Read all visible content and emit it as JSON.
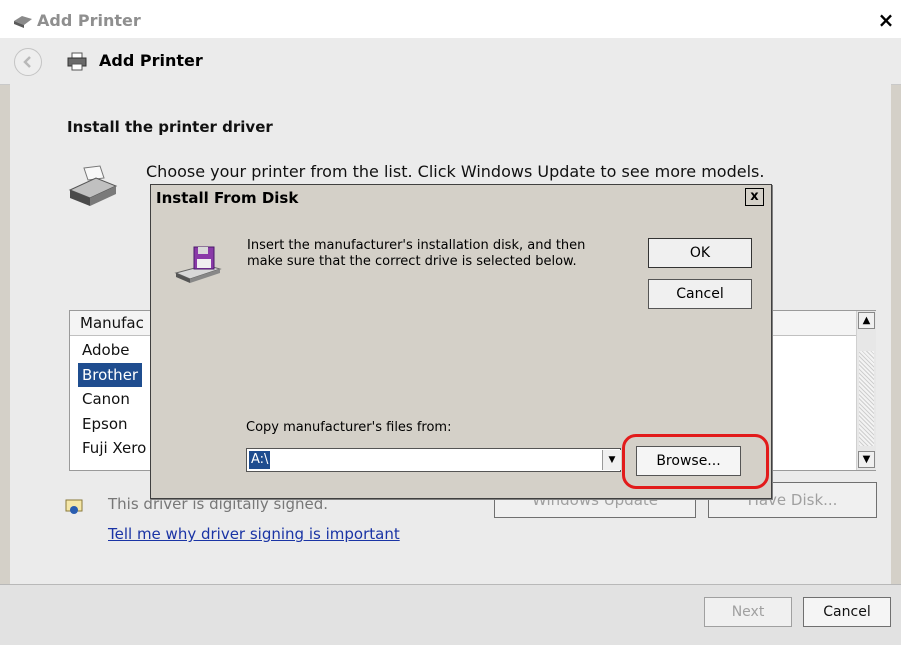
{
  "window": {
    "title": "Add Printer",
    "close_glyph": "×",
    "header_title": "Add Printer"
  },
  "page": {
    "section_title": "Install the printer driver",
    "instruction": "Choose your printer from the list. Click Windows Update to see more models.",
    "manufacturer_header": "Manufac",
    "manufacturers": [
      "Adobe",
      "Brother",
      "Canon",
      "Epson",
      "Fuji Xero"
    ],
    "selected_manufacturer": "Brother",
    "signed_text": "This driver is digitally signed.",
    "windows_update_label": "Windows Update",
    "have_disk_label": "Have Disk...",
    "why_link": "Tell me why driver signing is important",
    "next_label": "Next",
    "cancel_label": "Cancel"
  },
  "dialog": {
    "title": "Install From Disk",
    "close_glyph": "x",
    "message_line1": "Insert the manufacturer's installation disk, and then",
    "message_line2": "make sure that the correct drive is selected below.",
    "ok_label": "OK",
    "cancel_label": "Cancel",
    "copy_label": "Copy manufacturer's files from:",
    "copy_value": "A:\\",
    "browse_label": "Browse..."
  },
  "icons": {
    "back": "back-arrow-icon",
    "printer": "printer-icon",
    "disk": "floppy-disk-icon",
    "shield": "shield-icon"
  },
  "colors": {
    "selection": "#1f4d8f",
    "highlight_ring": "#e21b1b",
    "link": "#1a34a5"
  }
}
